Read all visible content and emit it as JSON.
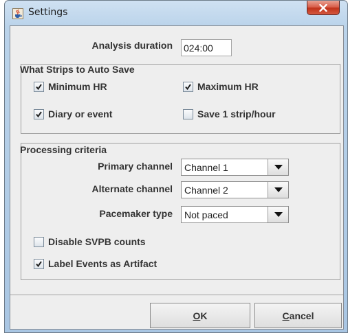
{
  "window": {
    "title": "Settings",
    "app_icon": "java-cup-icon",
    "close_icon": "close-icon",
    "close_color": "#c8432c"
  },
  "analysis": {
    "label": "Analysis duration",
    "value": "024:00"
  },
  "auto_save": {
    "title": "What Strips to Auto Save",
    "minimum_hr": {
      "label": "Minimum HR",
      "checked": true
    },
    "maximum_hr": {
      "label": "Maximum HR",
      "checked": true
    },
    "diary_event": {
      "label": "Diary or event",
      "checked": true
    },
    "save_strip": {
      "label": "Save 1 strip/hour",
      "checked": false
    }
  },
  "processing": {
    "title": "Processing criteria",
    "primary": {
      "label": "Primary channel",
      "value": "Channel 1"
    },
    "alternate": {
      "label": "Alternate channel",
      "value": "Channel 2"
    },
    "pacemaker": {
      "label": "Pacemaker type",
      "value": "Not paced"
    },
    "disable_svpb": {
      "label": "Disable SVPB counts",
      "checked": false
    },
    "label_events": {
      "label": "Label Events as Artifact",
      "checked": true
    }
  },
  "buttons": {
    "ok": {
      "mnemonic": "O",
      "rest": "K"
    },
    "cancel": {
      "mnemonic": "C",
      "rest": "ancel"
    }
  }
}
